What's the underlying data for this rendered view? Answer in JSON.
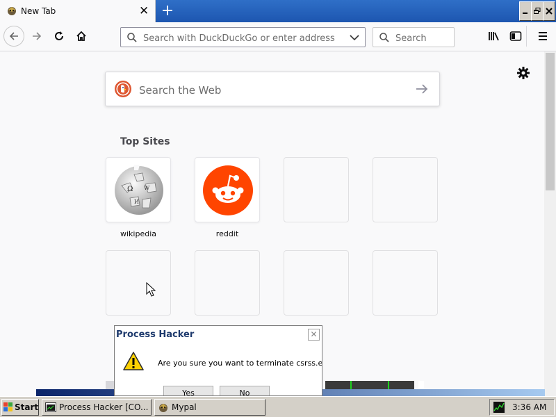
{
  "browser": {
    "tab": {
      "title": "New Tab",
      "close": "✕"
    },
    "new_tab": "+",
    "window_buttons": {
      "minimize": "_",
      "restore": "🗗",
      "close": "✕"
    },
    "urlbar_placeholder": "Search with DuckDuckGo or enter address",
    "searchbar_placeholder": "Search",
    "accent": "#2a62bd"
  },
  "newtab": {
    "search_placeholder": "Search the Web",
    "top_sites_heading": "Top Sites",
    "sites": [
      {
        "label": "wikipedia"
      },
      {
        "label": "reddit"
      }
    ]
  },
  "dialog": {
    "title": "Process Hacker",
    "message": "Are you sure you want to terminate csrss.exe?",
    "yes": "Yes",
    "no": "No",
    "close": "✕"
  },
  "taskbar": {
    "start": "Start",
    "tasks": [
      {
        "label": "Process Hacker [CO..."
      },
      {
        "label": "Mypal"
      }
    ],
    "clock": "3:36 AM"
  }
}
